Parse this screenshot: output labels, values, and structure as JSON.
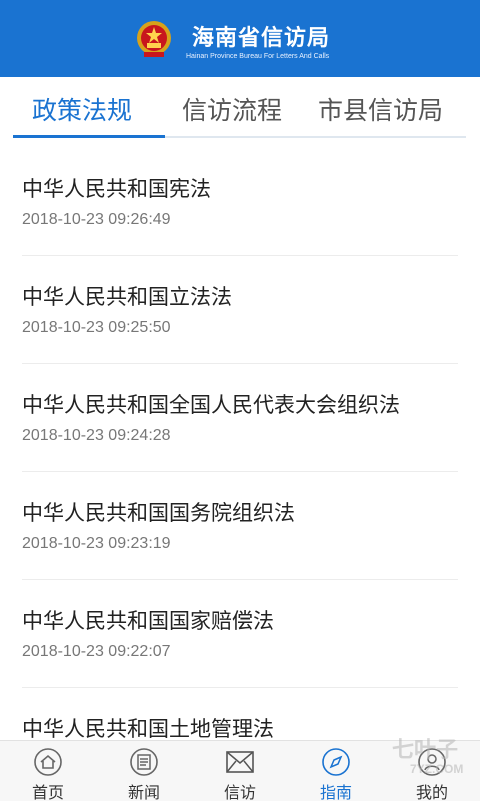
{
  "header": {
    "title": "海南省信访局",
    "subtitle": "Hainan Province Bureau For Letters And Calls"
  },
  "tabs": [
    {
      "label": "政策法规",
      "active": true
    },
    {
      "label": "信访流程",
      "active": false
    },
    {
      "label": "市县信访局",
      "active": false
    }
  ],
  "list": [
    {
      "title": "中华人民共和国宪法",
      "time": "2018-10-23 09:26:49"
    },
    {
      "title": "中华人民共和国立法法",
      "time": "2018-10-23 09:25:50"
    },
    {
      "title": "中华人民共和国全国人民代表大会组织法",
      "time": "2018-10-23 09:24:28"
    },
    {
      "title": "中华人民共和国国务院组织法",
      "time": "2018-10-23 09:23:19"
    },
    {
      "title": "中华人民共和国国家赔偿法",
      "time": "2018-10-23 09:22:07"
    },
    {
      "title": "中华人民共和国土地管理法",
      "time": ""
    }
  ],
  "bottom_nav": [
    {
      "label": "首页",
      "icon": "home-icon",
      "active": false
    },
    {
      "label": "新闻",
      "icon": "news-icon",
      "active": false
    },
    {
      "label": "信访",
      "icon": "mail-icon",
      "active": false
    },
    {
      "label": "指南",
      "icon": "compass-icon",
      "active": true
    },
    {
      "label": "我的",
      "icon": "user-icon",
      "active": false
    }
  ],
  "watermark": {
    "cn": "七叶子",
    "en": "7YZ.COM"
  },
  "colors": {
    "brand": "#1a73d1"
  }
}
